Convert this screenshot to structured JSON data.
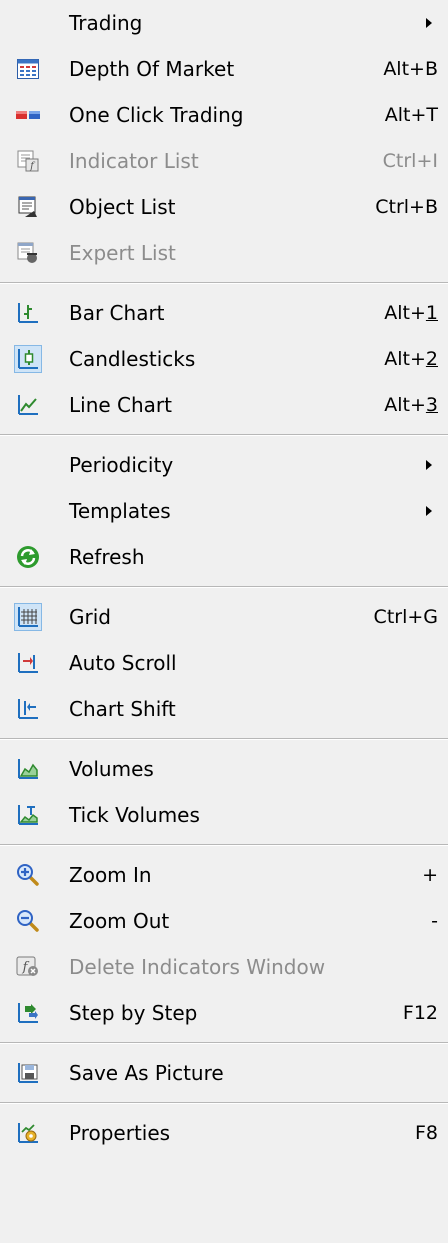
{
  "menu": {
    "trading": {
      "label": "Trading"
    },
    "depth_of_market": {
      "label": "Depth Of Market",
      "shortcut": "Alt+B"
    },
    "one_click_trading": {
      "label": "One Click Trading",
      "shortcut": "Alt+T"
    },
    "indicator_list": {
      "label": "Indicator List",
      "shortcut": "Ctrl+I"
    },
    "object_list": {
      "label": "Object List",
      "shortcut": "Ctrl+B"
    },
    "expert_list": {
      "label": "Expert List"
    },
    "bar_chart": {
      "label": "Bar Chart",
      "shortcut_prefix": "Alt+",
      "shortcut_key": "1"
    },
    "candlesticks": {
      "label": "Candlesticks",
      "shortcut_prefix": "Alt+",
      "shortcut_key": "2"
    },
    "line_chart": {
      "label": "Line Chart",
      "shortcut_prefix": "Alt+",
      "shortcut_key": "3"
    },
    "periodicity": {
      "label": "Periodicity"
    },
    "templates": {
      "label": "Templates"
    },
    "refresh": {
      "label": "Refresh"
    },
    "grid": {
      "label": "Grid",
      "shortcut": "Ctrl+G"
    },
    "auto_scroll": {
      "label": "Auto Scroll"
    },
    "chart_shift": {
      "label": "Chart Shift"
    },
    "volumes": {
      "label": "Volumes"
    },
    "tick_volumes": {
      "label": "Tick Volumes"
    },
    "zoom_in": {
      "label": "Zoom In",
      "shortcut": "+"
    },
    "zoom_out": {
      "label": "Zoom Out",
      "shortcut": "-"
    },
    "delete_indicators_window": {
      "label": "Delete Indicators Window"
    },
    "step_by_step": {
      "label": "Step by Step",
      "shortcut": "F12"
    },
    "save_as_picture": {
      "label": "Save As Picture"
    },
    "properties": {
      "label": "Properties",
      "shortcut": "F8"
    }
  },
  "icons": {
    "depth_of_market": "depth-of-market-icon",
    "one_click_trading": "one-click-trading-icon",
    "indicator_list": "indicator-list-icon",
    "object_list": "object-list-icon",
    "expert_list": "expert-list-icon",
    "bar_chart": "bar-chart-icon",
    "candlesticks": "candlesticks-icon",
    "line_chart": "line-chart-icon",
    "refresh": "refresh-icon",
    "grid": "grid-icon",
    "auto_scroll": "auto-scroll-icon",
    "chart_shift": "chart-shift-icon",
    "volumes": "volumes-icon",
    "tick_volumes": "tick-volumes-icon",
    "zoom_in": "zoom-in-icon",
    "zoom_out": "zoom-out-icon",
    "delete_indicators_window": "delete-indicators-window-icon",
    "step_by_step": "step-by-step-icon",
    "save_as_picture": "save-as-picture-icon",
    "properties": "properties-icon"
  },
  "colors": {
    "menu_background": "#f0f0f0",
    "disabled_text": "#8c8c8c",
    "checked_highlight": "#cfe4f7",
    "chart_icon_blue": "#1f6fbf",
    "refresh_green": "#2e9b2e"
  }
}
